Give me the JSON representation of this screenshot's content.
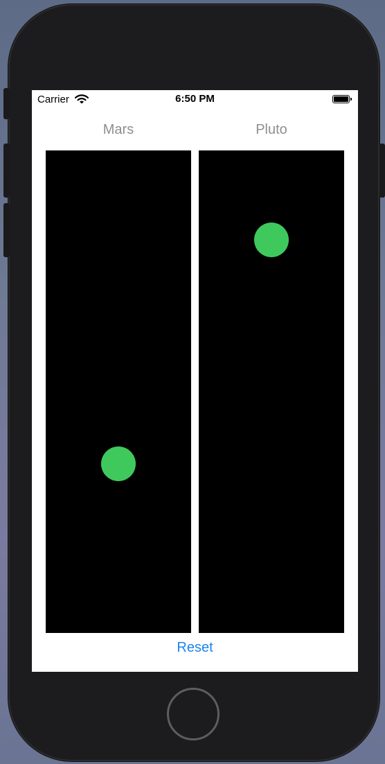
{
  "status_bar": {
    "carrier": "Carrier",
    "time": "6:50 PM",
    "wifi_icon": "wifi-icon",
    "battery_icon": "battery-icon"
  },
  "columns": [
    {
      "label": "Mars",
      "puck_level": 0.65
    },
    {
      "label": "Pluto",
      "puck_level": 0.185
    }
  ],
  "reset_label": "Reset",
  "colors": {
    "puck": "#3fc95d",
    "track": "#000000",
    "label": "#8e8e93",
    "link": "#1b84f0"
  }
}
